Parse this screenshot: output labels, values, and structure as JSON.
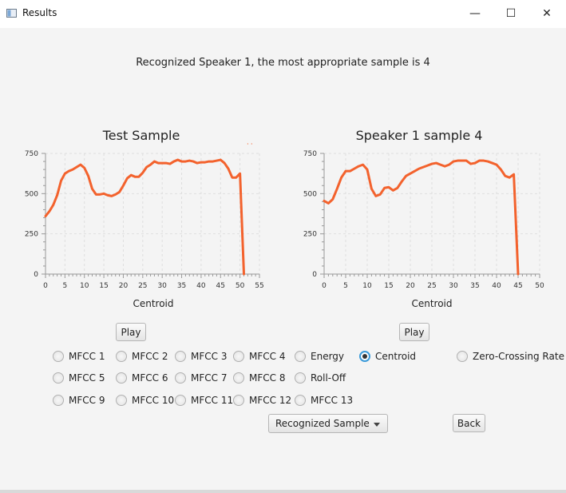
{
  "window": {
    "title": "Results",
    "minimize": "—",
    "maximize": "☐",
    "close": "✕"
  },
  "message": "Recognized Speaker 1, the most appropriate sample is 4",
  "colors": {
    "series": "#f3622d",
    "selected_radio": "#3a9ad9"
  },
  "chart_data": [
    {
      "type": "line",
      "title": "Test Sample",
      "xlabel": "Centroid",
      "ylabel": "",
      "xlim": [
        0,
        55
      ],
      "ylim": [
        0,
        750
      ],
      "xticks": [
        0,
        5,
        10,
        15,
        20,
        25,
        30,
        35,
        40,
        45,
        50,
        55
      ],
      "yticks": [
        0,
        250,
        500,
        750
      ],
      "grid": true,
      "legend": "none",
      "x": [
        0,
        1,
        2,
        3,
        4,
        5,
        6,
        7,
        8,
        9,
        10,
        11,
        12,
        13,
        14,
        15,
        16,
        17,
        18,
        19,
        20,
        21,
        22,
        23,
        24,
        25,
        26,
        27,
        28,
        29,
        30,
        31,
        32,
        33,
        34,
        35,
        36,
        37,
        38,
        39,
        40,
        41,
        42,
        43,
        44,
        45,
        46,
        47,
        48,
        49,
        50,
        51,
        52,
        53
      ],
      "values": [
        360,
        390,
        430,
        490,
        580,
        625,
        640,
        650,
        665,
        680,
        660,
        610,
        530,
        495,
        495,
        500,
        490,
        485,
        495,
        510,
        550,
        595,
        615,
        605,
        605,
        630,
        665,
        680,
        700,
        690,
        690,
        690,
        685,
        700,
        710,
        700,
        700,
        705,
        700,
        690,
        695,
        695,
        700,
        700,
        705,
        710,
        690,
        655,
        600,
        600,
        625,
        0
      ]
    },
    {
      "type": "line",
      "title": "Speaker 1 sample 4",
      "xlabel": "Centroid",
      "ylabel": "",
      "xlim": [
        0,
        50
      ],
      "ylim": [
        0,
        750
      ],
      "xticks": [
        0,
        5,
        10,
        15,
        20,
        25,
        30,
        35,
        40,
        45,
        50
      ],
      "yticks": [
        0,
        250,
        500,
        750
      ],
      "grid": true,
      "legend": "none",
      "x": [
        0,
        1,
        2,
        3,
        4,
        5,
        6,
        7,
        8,
        9,
        10,
        11,
        12,
        13,
        14,
        15,
        16,
        17,
        18,
        19,
        20,
        21,
        22,
        23,
        24,
        25,
        26,
        27,
        28,
        29,
        30,
        31,
        32,
        33,
        34,
        35,
        36,
        37,
        38,
        39,
        40,
        41,
        42,
        43,
        44,
        45
      ],
      "values": [
        455,
        440,
        465,
        530,
        600,
        640,
        640,
        655,
        670,
        680,
        650,
        530,
        485,
        495,
        535,
        540,
        520,
        535,
        575,
        610,
        625,
        640,
        655,
        665,
        675,
        685,
        690,
        680,
        670,
        680,
        700,
        705,
        705,
        705,
        685,
        690,
        705,
        705,
        700,
        690,
        680,
        650,
        610,
        600,
        620,
        0
      ]
    }
  ],
  "controls": {
    "play_left": "Play",
    "play_right": "Play",
    "radio_options": [
      {
        "label": "MFCC 1",
        "selected": false
      },
      {
        "label": "MFCC 2",
        "selected": false
      },
      {
        "label": "MFCC 3",
        "selected": false
      },
      {
        "label": "MFCC 4",
        "selected": false
      },
      {
        "label": "Energy",
        "selected": false
      },
      {
        "label": "Centroid",
        "selected": true
      },
      {
        "label": "Zero-Crossing Rate",
        "selected": false
      },
      {
        "label": "MFCC 5",
        "selected": false
      },
      {
        "label": "MFCC 6",
        "selected": false
      },
      {
        "label": "MFCC 7",
        "selected": false
      },
      {
        "label": "MFCC 8",
        "selected": false
      },
      {
        "label": "Roll-Off",
        "selected": false
      },
      {
        "label": "MFCC 9",
        "selected": false
      },
      {
        "label": "MFCC 10",
        "selected": false
      },
      {
        "label": "MFCC 11",
        "selected": false
      },
      {
        "label": "MFCC 12",
        "selected": false
      },
      {
        "label": "MFCC 13",
        "selected": false
      }
    ],
    "sample_select": "Recognized Sample",
    "back": "Back"
  }
}
